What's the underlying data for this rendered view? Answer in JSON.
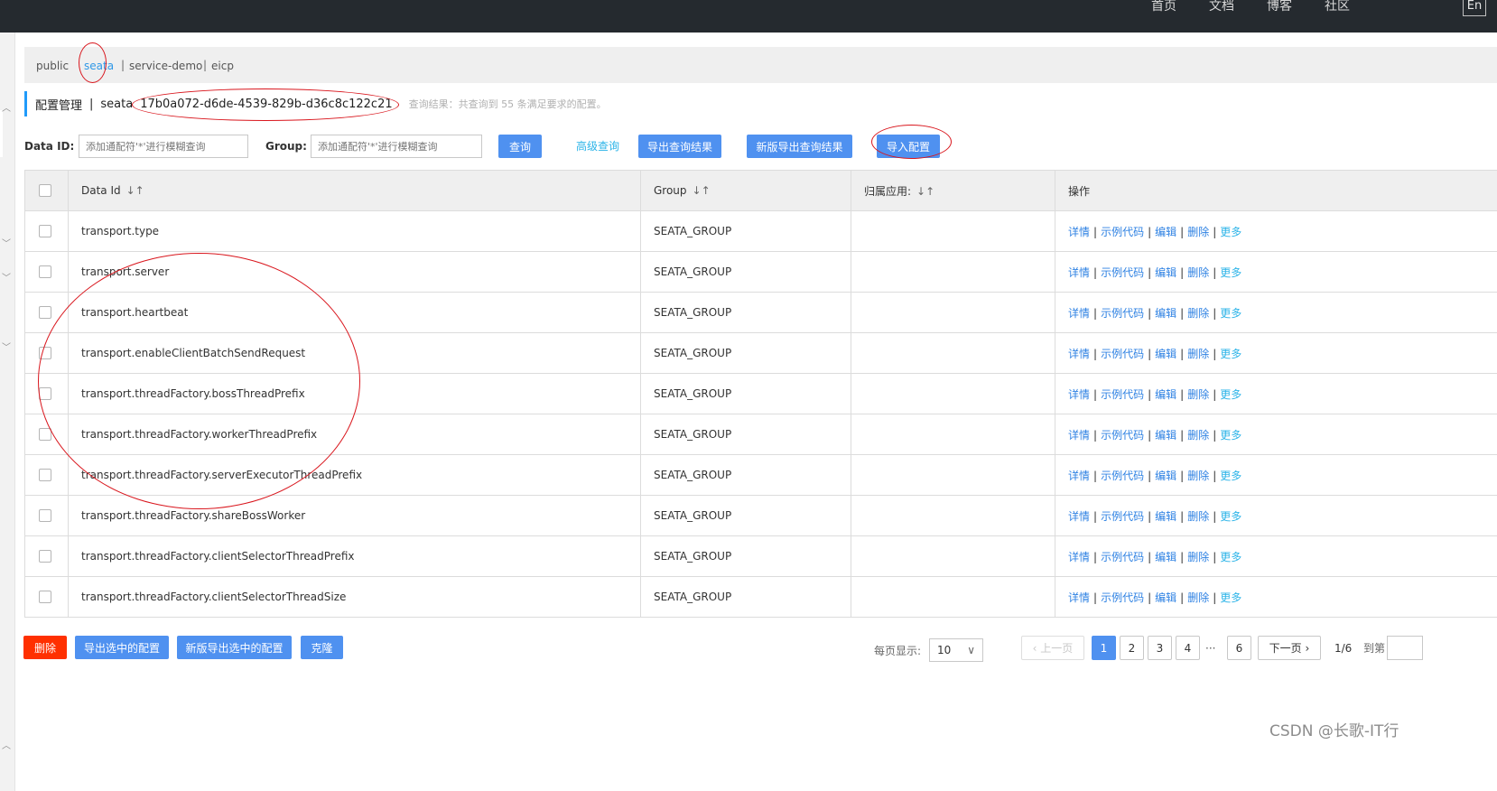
{
  "topnav": {
    "links": [
      "首页",
      "文档",
      "博客",
      "社区"
    ],
    "lang": "En"
  },
  "namespaces": [
    {
      "label": "public",
      "active": false
    },
    {
      "label": "seata",
      "active": true
    },
    {
      "label": "service-demo",
      "active": false
    },
    {
      "label": "eicp",
      "active": false
    }
  ],
  "ns_separator": "|",
  "header": {
    "title": "配置管理",
    "separator": "|",
    "namespace": "seata",
    "namespace_id": "17b0a072-d6de-4539-829b-d36c8c122c21",
    "result_text": "查询结果：共查询到 55 条满足要求的配置。"
  },
  "search": {
    "data_id_label": "Data ID:",
    "data_id_placeholder": "添加通配符'*'进行模糊查询",
    "group_label": "Group:",
    "group_placeholder": "添加通配符'*'进行模糊查询",
    "query_button": "查询",
    "advanced_link": "高级查询",
    "export_button": "导出查询结果",
    "new_export_button": "新版导出查询结果",
    "import_button": "导入配置"
  },
  "table": {
    "columns": [
      "Data Id",
      "Group",
      "归属应用:",
      "操作"
    ],
    "operations": [
      "详情",
      "示例代码",
      "编辑",
      "删除",
      "更多"
    ],
    "rows": [
      {
        "data_id": "transport.type",
        "group": "SEATA_GROUP",
        "app": ""
      },
      {
        "data_id": "transport.server",
        "group": "SEATA_GROUP",
        "app": ""
      },
      {
        "data_id": "transport.heartbeat",
        "group": "SEATA_GROUP",
        "app": ""
      },
      {
        "data_id": "transport.enableClientBatchSendRequest",
        "group": "SEATA_GROUP",
        "app": ""
      },
      {
        "data_id": "transport.threadFactory.bossThreadPrefix",
        "group": "SEATA_GROUP",
        "app": ""
      },
      {
        "data_id": "transport.threadFactory.workerThreadPrefix",
        "group": "SEATA_GROUP",
        "app": ""
      },
      {
        "data_id": "transport.threadFactory.serverExecutorThreadPrefix",
        "group": "SEATA_GROUP",
        "app": ""
      },
      {
        "data_id": "transport.threadFactory.shareBossWorker",
        "group": "SEATA_GROUP",
        "app": ""
      },
      {
        "data_id": "transport.threadFactory.clientSelectorThreadPrefix",
        "group": "SEATA_GROUP",
        "app": ""
      },
      {
        "data_id": "transport.threadFactory.clientSelectorThreadSize",
        "group": "SEATA_GROUP",
        "app": ""
      }
    ]
  },
  "actions": {
    "delete": "删除",
    "export_selected": "导出选中的配置",
    "new_export_selected": "新版导出选中的配置",
    "clone": "克隆"
  },
  "pagination": {
    "page_size_label": "每页显示:",
    "page_size": "10",
    "prev": "上一页",
    "pages": [
      "1",
      "2",
      "3",
      "4"
    ],
    "ellipsis": "···",
    "last_page": "6",
    "next": "下一页",
    "page_info": "1/6",
    "goto_label": "到第"
  },
  "watermark": "CSDN @长歌-IT行",
  "colors": {
    "accent": "#4f91f0",
    "danger": "#ff3000",
    "annotation": "#d9161d",
    "nav_bg": "#252a2f"
  }
}
